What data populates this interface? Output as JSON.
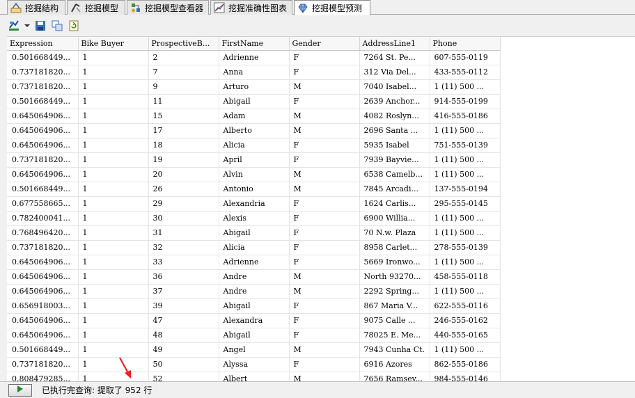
{
  "tabs": [
    {
      "label": "挖掘结构",
      "icon": "structure-icon",
      "active": false
    },
    {
      "label": "挖掘模型",
      "icon": "model-icon",
      "active": false
    },
    {
      "label": "挖掘模型查看器",
      "icon": "viewer-icon",
      "active": false
    },
    {
      "label": "挖掘准确性图表",
      "icon": "chart-icon",
      "active": false
    },
    {
      "label": "挖掘模型预测",
      "icon": "gem-icon",
      "active": true
    }
  ],
  "toolbar": {
    "icons": [
      "design-mode-icon",
      "dropdown-arrow-icon",
      "save-icon",
      "copy-icon",
      "refresh-icon"
    ]
  },
  "grid": {
    "columns": [
      "Expression",
      "Bike Buyer",
      "ProspectiveB...",
      "FirstName",
      "Gender",
      "AddressLine1",
      "Phone"
    ],
    "rows": [
      [
        "0.501668449...",
        "1",
        "2",
        "Adrienne",
        "F",
        "7264 St. Pe...",
        "607-555-0119"
      ],
      [
        "0.737181820...",
        "1",
        "7",
        "Anna",
        "F",
        "312 Via Del...",
        "433-555-0112"
      ],
      [
        "0.737181820...",
        "1",
        "9",
        "Arturo",
        "M",
        "7040 Isabel...",
        "1 (11) 500 ..."
      ],
      [
        "0.501668449...",
        "1",
        "11",
        "Abigail",
        "F",
        "2639 Anchor...",
        "914-555-0199"
      ],
      [
        "0.645064906...",
        "1",
        "15",
        "Adam",
        "M",
        "4082 Roslyn...",
        "416-555-0186"
      ],
      [
        "0.645064906...",
        "1",
        "17",
        "Alberto",
        "M",
        "2696 Santa ...",
        "1 (11) 500 ..."
      ],
      [
        "0.645064906...",
        "1",
        "18",
        "Alicia",
        "F",
        "5935 Isabel",
        "751-555-0139"
      ],
      [
        "0.737181820...",
        "1",
        "19",
        "April",
        "F",
        "7939 Bayvie...",
        "1 (11) 500 ..."
      ],
      [
        "0.645064906...",
        "1",
        "20",
        "Alvin",
        "M",
        "6538 Camelb...",
        "1 (11) 500 ..."
      ],
      [
        "0.501668449...",
        "1",
        "26",
        "Antonio",
        "M",
        "7845 Arcadi...",
        "137-555-0194"
      ],
      [
        "0.677558665...",
        "1",
        "29",
        "Alexandria",
        "F",
        "1624 Carlis...",
        "295-555-0145"
      ],
      [
        "0.782400041...",
        "1",
        "30",
        "Alexis",
        "F",
        "6900 Willia...",
        "1 (11) 500 ..."
      ],
      [
        "0.768496420...",
        "1",
        "31",
        "Abigail",
        "F",
        "70 N.w. Plaza",
        "1 (11) 500 ..."
      ],
      [
        "0.737181820...",
        "1",
        "32",
        "Alicia",
        "F",
        "8958 Carlet...",
        "278-555-0139"
      ],
      [
        "0.645064906...",
        "1",
        "33",
        "Adrienne",
        "F",
        "5669 Ironwo...",
        "1 (11) 500 ..."
      ],
      [
        "0.645064906...",
        "1",
        "36",
        "Andre",
        "M",
        "North 93270...",
        "458-555-0118"
      ],
      [
        "0.645064906...",
        "1",
        "37",
        "Andre",
        "M",
        "2292 Spring...",
        "1 (11) 500 ..."
      ],
      [
        "0.656918003...",
        "1",
        "39",
        "Abigail",
        "F",
        "867 Maria V...",
        "622-555-0116"
      ],
      [
        "0.645064906...",
        "1",
        "47",
        "Alexandra",
        "F",
        "9075 Calle ...",
        "246-555-0162"
      ],
      [
        "0.645064906...",
        "1",
        "48",
        "Abigail",
        "F",
        "78025 E. Me...",
        "440-555-0165"
      ],
      [
        "0.501668449...",
        "1",
        "49",
        "Angel",
        "M",
        "7943 Cunha Ct.",
        "1 (11) 500 ..."
      ],
      [
        "0.737181820...",
        "1",
        "50",
        "Alyssa",
        "F",
        "6916 Azores",
        "862-555-0186"
      ],
      [
        "0.808479285...",
        "1",
        "52",
        "Albert",
        "M",
        "7656 Ramsey...",
        "984-555-0146"
      ]
    ]
  },
  "status": {
    "text": "已执行完查询: 提取了 952 行",
    "run_icon": "play-icon"
  },
  "annotation": {
    "icon": "red-arrow-icon",
    "color": "#e8231e"
  }
}
